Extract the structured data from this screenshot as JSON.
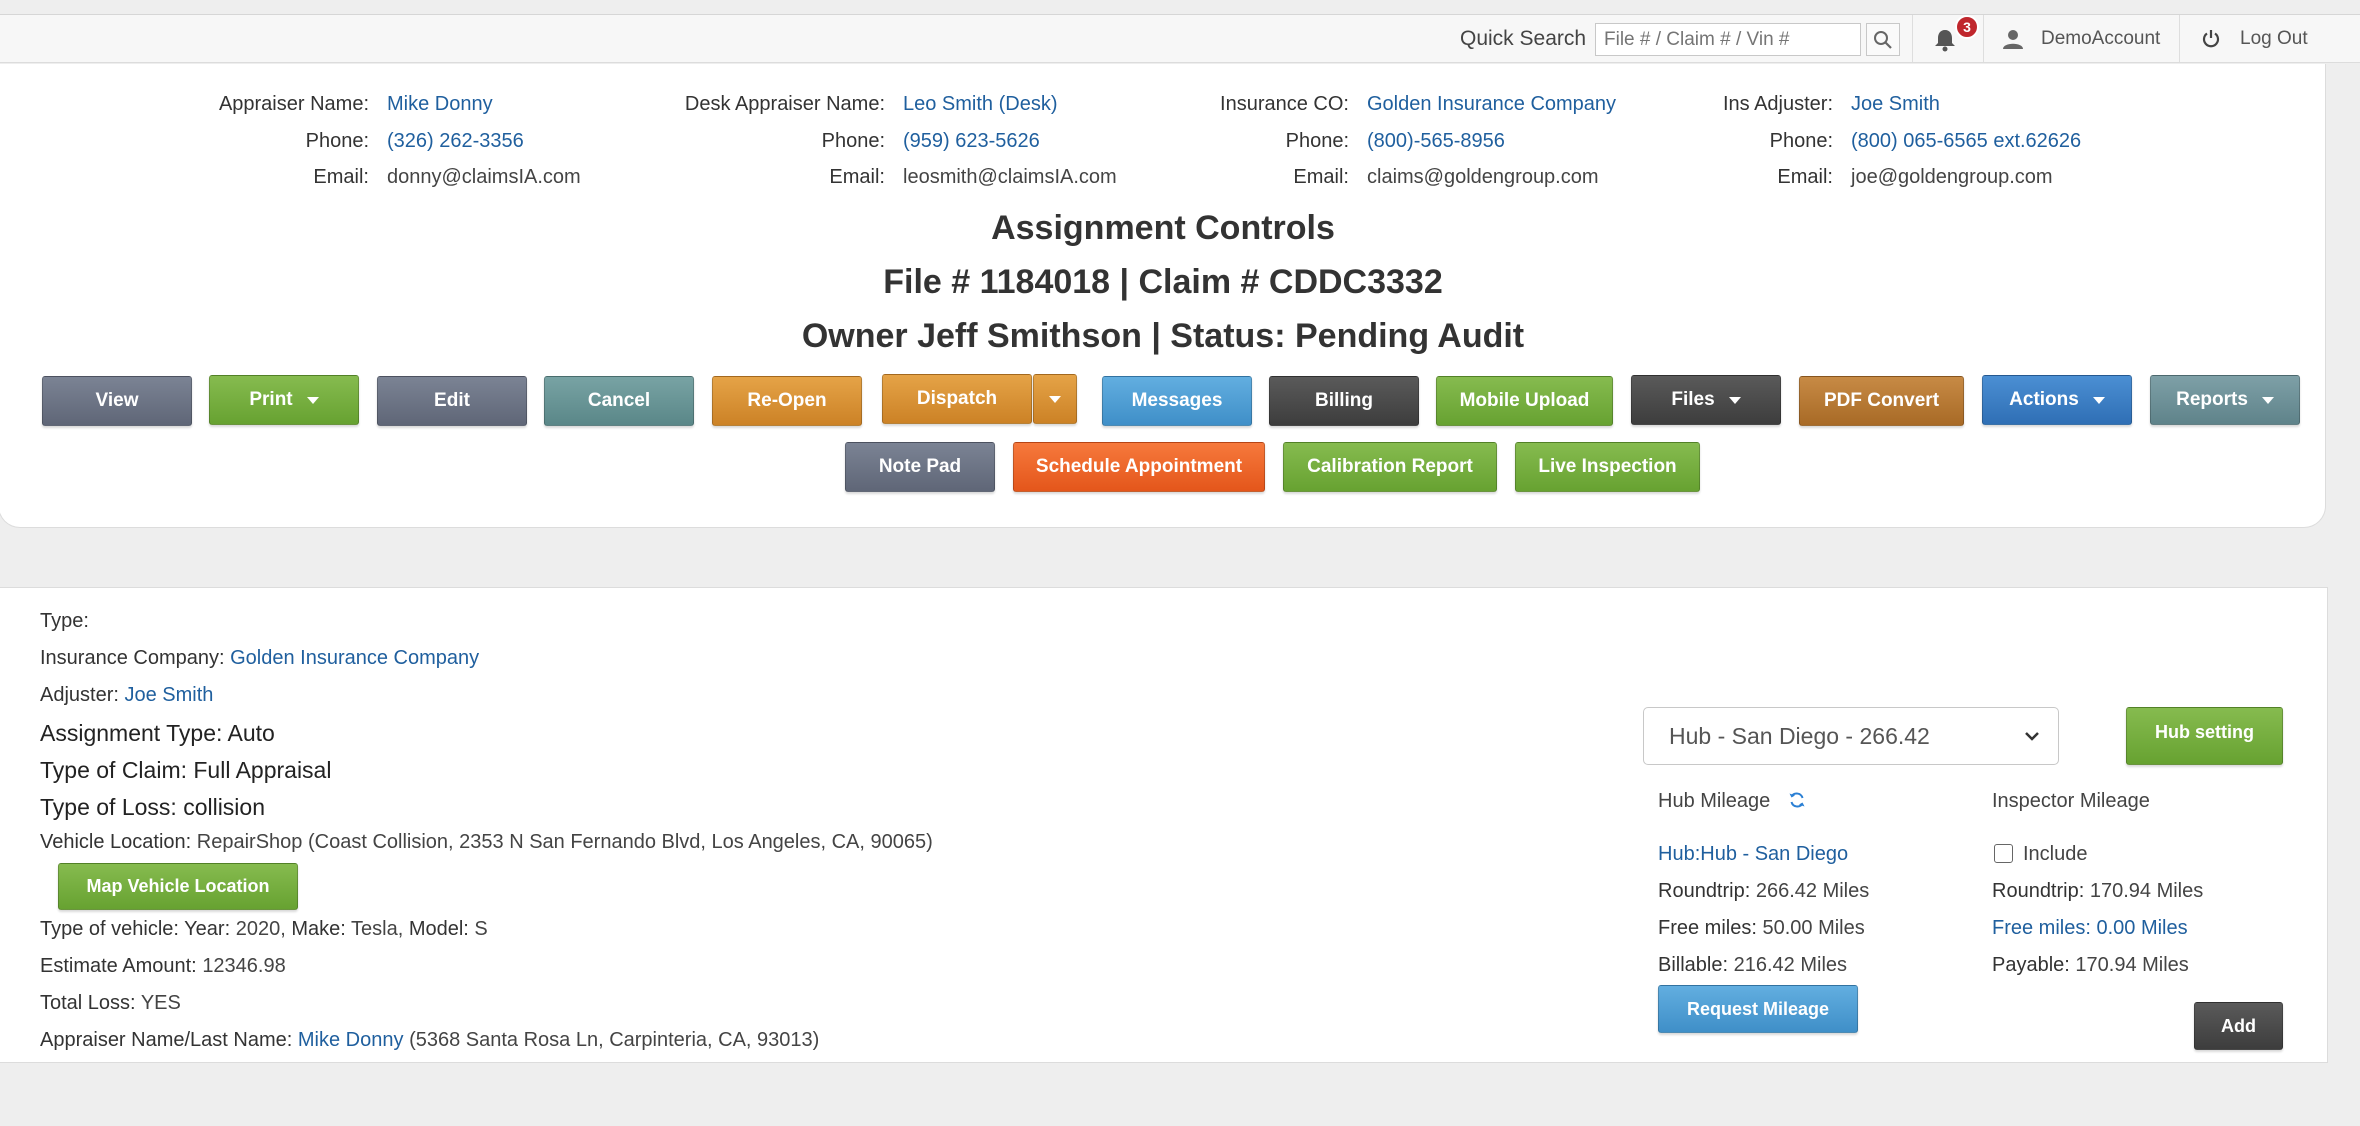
{
  "topbar": {
    "quick_search_label": "Quick Search",
    "quick_search_placeholder": "File # / Claim # / Vin #",
    "notification_count": "3",
    "account_label": "DemoAccount",
    "logout_label": "Log Out"
  },
  "contacts": {
    "appraiser": {
      "name_label": "Appraiser Name:",
      "name": "Mike Donny",
      "phone_label": "Phone:",
      "phone": "(326) 262-3356",
      "email_label": "Email:",
      "email": "donny@claimsIA.com"
    },
    "desk_appraiser": {
      "name_label": "Desk Appraiser Name:",
      "name": "Leo Smith (Desk)",
      "phone_label": "Phone:",
      "phone": "(959) 623-5626",
      "email_label": "Email:",
      "email": "leosmith@claimsIA.com"
    },
    "insurance": {
      "name_label": "Insurance CO:",
      "name": "Golden Insurance Company",
      "phone_label": "Phone:",
      "phone": "(800)-565-8956",
      "email_label": "Email:",
      "email": "claims@goldengroup.com"
    },
    "adjuster": {
      "name_label": "Ins Adjuster:",
      "name": "Joe Smith",
      "phone_label": "Phone:",
      "phone": "(800) 065-6565 ext.62626",
      "email_label": "Email:",
      "email": "joe@goldengroup.com"
    }
  },
  "controls": {
    "title": "Assignment Controls",
    "file_claim": "File # 1184018 | Claim # CDDC3332",
    "owner_status": "Owner Jeff Smithson | Status: Pending Audit"
  },
  "buttons": {
    "view": "View",
    "print": "Print",
    "edit": "Edit",
    "cancel": "Cancel",
    "reopen": "Re-Open",
    "dispatch": "Dispatch",
    "messages": "Messages",
    "billing": "Billing",
    "mobile_upload": "Mobile Upload",
    "files": "Files",
    "pdf_convert": "PDF Convert",
    "actions": "Actions",
    "reports": "Reports",
    "note_pad": "Note Pad",
    "schedule_appointment": "Schedule Appointment",
    "calibration_report": "Calibration Report",
    "live_inspection": "Live Inspection"
  },
  "details": {
    "type_label": "Type:",
    "insurance_company_label": "Insurance Company:",
    "insurance_company": "Golden Insurance Company",
    "adjuster_label": "Adjuster:",
    "adjuster": "Joe Smith",
    "assignment_type": "Assignment Type: Auto",
    "type_of_claim": "Type of Claim: Full Appraisal",
    "type_of_loss": "Type of Loss: collision",
    "vehicle_location_label": "Vehicle Location:",
    "vehicle_location": "RepairShop (Coast Collision, 2353 N San Fernando Blvd, Los Angeles, CA, 90065)",
    "map_button": "Map Vehicle Location",
    "vehicle_type_label": "Type of vehicle:",
    "year_label": "Year:",
    "year": "2020",
    "make_label": "Make:",
    "make": "Tesla",
    "model_label": "Model:",
    "model": "S",
    "estimate_label": "Estimate Amount:",
    "estimate": "12346.98",
    "total_loss_label": "Total Loss:",
    "total_loss": "YES",
    "appraiser_label": "Appraiser Name/Last Name:",
    "appraiser_name": "Mike Donny",
    "appraiser_address": "(5368 Santa Rosa Ln, Carpinteria, CA, 93013)"
  },
  "mileage": {
    "hub_select_value": "Hub - San Diego - 266.42",
    "hub_setting_button": "Hub setting",
    "hub_mileage_label": "Hub Mileage",
    "inspector_mileage_label": "Inspector Mileage",
    "hub_name": "Hub:Hub - San Diego",
    "roundtrip_label": "Roundtrip:",
    "hub_roundtrip": "266.42 Miles",
    "free_miles_label": "Free miles:",
    "hub_free_miles": "50.00 Miles",
    "billable_label": "Billable:",
    "hub_billable": "216.42 Miles",
    "request_mileage_button": "Request Mileage",
    "include_label": "Include",
    "insp_roundtrip": "170.94 Miles",
    "insp_free_miles": "Free miles: 0.00 Miles",
    "payable_label": "Payable:",
    "insp_payable": "170.94 Miles",
    "add_button": "Add"
  }
}
